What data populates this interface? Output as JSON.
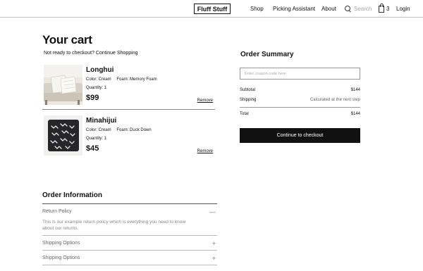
{
  "header": {
    "logo": "Fluff Stuff",
    "nav": [
      "Shop",
      "Picking Assistant",
      "About"
    ],
    "search_placeholder": "Search",
    "cart_count": "3",
    "login": "Login"
  },
  "cart": {
    "title": "Your cart",
    "continue_text": "Not ready to checkout? Continue Shopping",
    "items": [
      {
        "name": "Longhui",
        "color": "Color: Cream",
        "foam": "Foam: Memory Foam",
        "quantity": "Quantity: 1",
        "price": "$99",
        "remove": "Remove"
      },
      {
        "name": "Minahijui",
        "color": "Color: Cream",
        "foam": "Foam: Duck Down",
        "quantity": "Quantity: 1",
        "price": "$45",
        "remove": "Remove"
      }
    ]
  },
  "summary": {
    "title": "Order Summary",
    "coupon_placeholder": "Enter coupon code here",
    "subtotal_label": "Subtotal",
    "subtotal_value": "$144",
    "shipping_label": "Shipping",
    "shipping_value": "Calculated at the next step",
    "total_label": "Total",
    "total_value": "$144",
    "checkout": "Continue to checkout"
  },
  "order_info": {
    "title": "Order Information",
    "sections": [
      {
        "label": "Return Policy",
        "toggle": "—",
        "body": "This is our example return policy which is everything you need to know about our returns."
      },
      {
        "label": "Shipping Options",
        "toggle": "+"
      },
      {
        "label": "Shipping Options",
        "toggle": "+"
      }
    ]
  }
}
